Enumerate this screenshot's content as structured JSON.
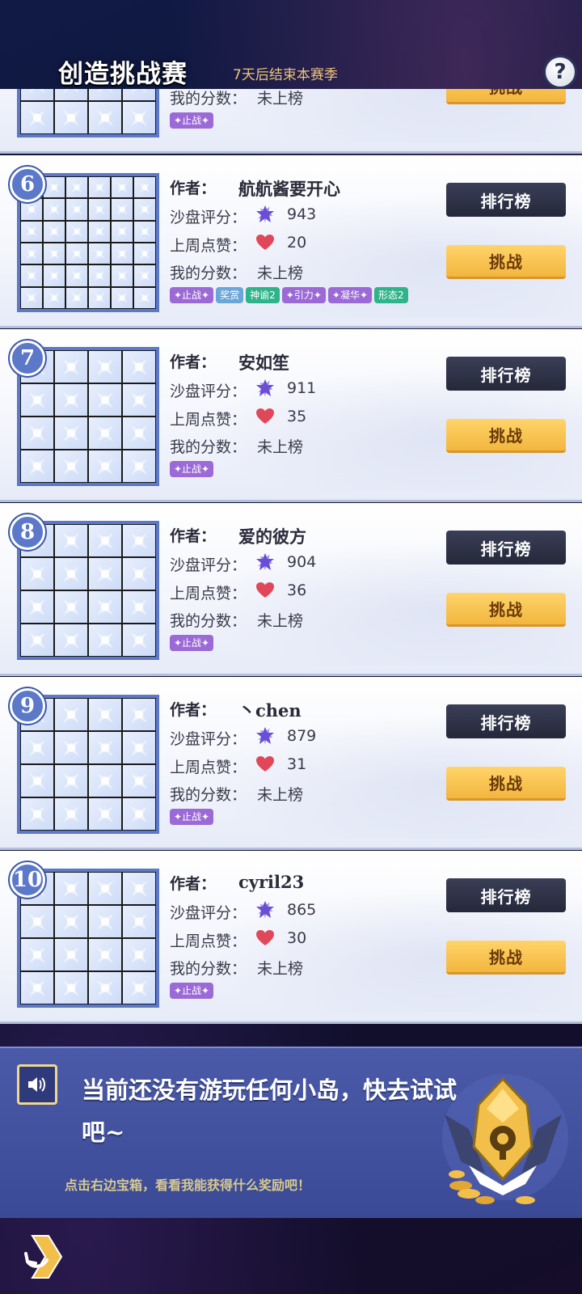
{
  "header": {
    "title": "创造挑战赛",
    "season_text": "7天后结束本赛季",
    "help_label": "?"
  },
  "labels": {
    "author": "作者：",
    "rating": "沙盘评分：",
    "likes": "上周点赞：",
    "my_score": "我的分数：",
    "rank_button": "排行榜",
    "challenge_button": "挑战"
  },
  "partial_entry": {
    "my_score": "未上榜",
    "tags": [
      {
        "text": "✦止战✦",
        "color": "purple"
      }
    ]
  },
  "entries": [
    {
      "rank": "6",
      "author": "航航酱要开心",
      "rating": "943",
      "likes": "20",
      "my_score": "未上榜",
      "grid": 6,
      "tags": [
        {
          "text": "✦止战✦",
          "color": "purple"
        },
        {
          "text": "奖赏",
          "color": "blue"
        },
        {
          "text": "神谕2",
          "color": "teal"
        },
        {
          "text": "✦引力✦",
          "color": "purple"
        },
        {
          "text": "✦凝华✦",
          "color": "purple"
        },
        {
          "text": "形态2",
          "color": "teal"
        }
      ]
    },
    {
      "rank": "7",
      "author": "安如笙",
      "rating": "911",
      "likes": "35",
      "my_score": "未上榜",
      "grid": 4,
      "tags": [
        {
          "text": "✦止战✦",
          "color": "purple"
        }
      ]
    },
    {
      "rank": "8",
      "author": "爱的彼方",
      "rating": "904",
      "likes": "36",
      "my_score": "未上榜",
      "grid": 4,
      "tags": [
        {
          "text": "✦止战✦",
          "color": "purple"
        }
      ]
    },
    {
      "rank": "9",
      "author": "丶chen",
      "rating": "879",
      "likes": "31",
      "my_score": "未上榜",
      "grid": 4,
      "tags": [
        {
          "text": "✦止战✦",
          "color": "purple"
        }
      ]
    },
    {
      "rank": "10",
      "author": "cyril23",
      "rating": "865",
      "likes": "30",
      "my_score": "未上榜",
      "grid": 4,
      "tags": [
        {
          "text": "✦止战✦",
          "color": "purple"
        }
      ]
    }
  ],
  "banner": {
    "message": "当前还没有游玩任何小岛，快去试试吧~",
    "hint": "点击右边宝箱，看看我能获得什么奖励吧！"
  },
  "icons": {
    "rating": "star-icon",
    "likes": "heart-icon",
    "sound": "speaker-icon",
    "chest": "treasure-chest-icon",
    "back": "back-arrow-icon"
  },
  "colors": {
    "star": "#6b4fd8",
    "heart": "#e0485a",
    "challenge": "#f2b63e",
    "rank_button": "#2b2e42"
  }
}
